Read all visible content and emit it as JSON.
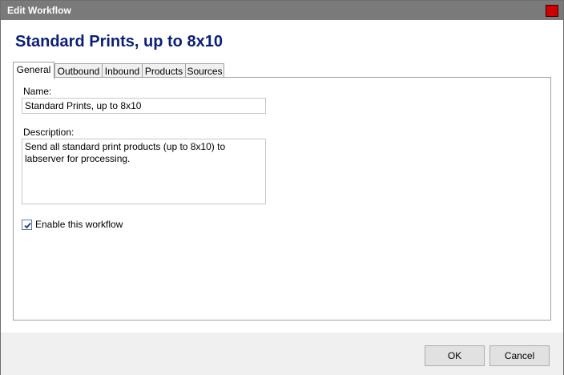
{
  "window": {
    "title": "Edit Workflow"
  },
  "heading": "Standard Prints, up to 8x10",
  "tabs": [
    {
      "label": "General",
      "active": true
    },
    {
      "label": "Outbound",
      "active": false
    },
    {
      "label": "Inbound",
      "active": false
    },
    {
      "label": "Products",
      "active": false
    },
    {
      "label": "Sources",
      "active": false
    }
  ],
  "general": {
    "name_label": "Name:",
    "name_value": "Standard Prints, up to 8x10",
    "description_label": "Description:",
    "description_value": "Send all standard print products (up to 8x10) to labserver for processing.",
    "enable_label": "Enable this workflow",
    "enable_checked": true
  },
  "footer": {
    "ok_label": "OK",
    "cancel_label": "Cancel"
  },
  "colors": {
    "titlebar": "#7a7a7a",
    "close_button": "#d10000",
    "heading": "#0b1f7a"
  },
  "icons": {
    "close": "close-icon",
    "check": "check-icon"
  }
}
